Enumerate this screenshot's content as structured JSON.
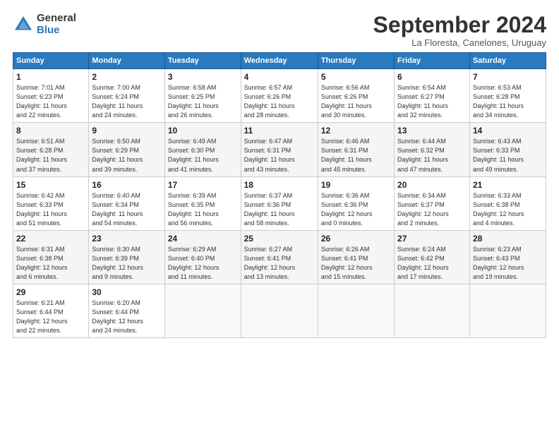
{
  "logo": {
    "general": "General",
    "blue": "Blue"
  },
  "title": "September 2024",
  "subtitle": "La Floresta, Canelones, Uruguay",
  "headers": [
    "Sunday",
    "Monday",
    "Tuesday",
    "Wednesday",
    "Thursday",
    "Friday",
    "Saturday"
  ],
  "weeks": [
    [
      {
        "day": "1",
        "info": "Sunrise: 7:01 AM\nSunset: 6:23 PM\nDaylight: 11 hours\nand 22 minutes."
      },
      {
        "day": "2",
        "info": "Sunrise: 7:00 AM\nSunset: 6:24 PM\nDaylight: 11 hours\nand 24 minutes."
      },
      {
        "day": "3",
        "info": "Sunrise: 6:58 AM\nSunset: 6:25 PM\nDaylight: 11 hours\nand 26 minutes."
      },
      {
        "day": "4",
        "info": "Sunrise: 6:57 AM\nSunset: 6:26 PM\nDaylight: 11 hours\nand 28 minutes."
      },
      {
        "day": "5",
        "info": "Sunrise: 6:56 AM\nSunset: 6:26 PM\nDaylight: 11 hours\nand 30 minutes."
      },
      {
        "day": "6",
        "info": "Sunrise: 6:54 AM\nSunset: 6:27 PM\nDaylight: 11 hours\nand 32 minutes."
      },
      {
        "day": "7",
        "info": "Sunrise: 6:53 AM\nSunset: 6:28 PM\nDaylight: 11 hours\nand 34 minutes."
      }
    ],
    [
      {
        "day": "8",
        "info": "Sunrise: 6:51 AM\nSunset: 6:28 PM\nDaylight: 11 hours\nand 37 minutes."
      },
      {
        "day": "9",
        "info": "Sunrise: 6:50 AM\nSunset: 6:29 PM\nDaylight: 11 hours\nand 39 minutes."
      },
      {
        "day": "10",
        "info": "Sunrise: 6:49 AM\nSunset: 6:30 PM\nDaylight: 11 hours\nand 41 minutes."
      },
      {
        "day": "11",
        "info": "Sunrise: 6:47 AM\nSunset: 6:31 PM\nDaylight: 11 hours\nand 43 minutes."
      },
      {
        "day": "12",
        "info": "Sunrise: 6:46 AM\nSunset: 6:31 PM\nDaylight: 11 hours\nand 45 minutes."
      },
      {
        "day": "13",
        "info": "Sunrise: 6:44 AM\nSunset: 6:32 PM\nDaylight: 11 hours\nand 47 minutes."
      },
      {
        "day": "14",
        "info": "Sunrise: 6:43 AM\nSunset: 6:33 PM\nDaylight: 11 hours\nand 49 minutes."
      }
    ],
    [
      {
        "day": "15",
        "info": "Sunrise: 6:42 AM\nSunset: 6:33 PM\nDaylight: 11 hours\nand 51 minutes."
      },
      {
        "day": "16",
        "info": "Sunrise: 6:40 AM\nSunset: 6:34 PM\nDaylight: 11 hours\nand 54 minutes."
      },
      {
        "day": "17",
        "info": "Sunrise: 6:39 AM\nSunset: 6:35 PM\nDaylight: 11 hours\nand 56 minutes."
      },
      {
        "day": "18",
        "info": "Sunrise: 6:37 AM\nSunset: 6:36 PM\nDaylight: 11 hours\nand 58 minutes."
      },
      {
        "day": "19",
        "info": "Sunrise: 6:36 AM\nSunset: 6:36 PM\nDaylight: 12 hours\nand 0 minutes."
      },
      {
        "day": "20",
        "info": "Sunrise: 6:34 AM\nSunset: 6:37 PM\nDaylight: 12 hours\nand 2 minutes."
      },
      {
        "day": "21",
        "info": "Sunrise: 6:33 AM\nSunset: 6:38 PM\nDaylight: 12 hours\nand 4 minutes."
      }
    ],
    [
      {
        "day": "22",
        "info": "Sunrise: 6:31 AM\nSunset: 6:38 PM\nDaylight: 12 hours\nand 6 minutes."
      },
      {
        "day": "23",
        "info": "Sunrise: 6:30 AM\nSunset: 6:39 PM\nDaylight: 12 hours\nand 9 minutes."
      },
      {
        "day": "24",
        "info": "Sunrise: 6:29 AM\nSunset: 6:40 PM\nDaylight: 12 hours\nand 11 minutes."
      },
      {
        "day": "25",
        "info": "Sunrise: 6:27 AM\nSunset: 6:41 PM\nDaylight: 12 hours\nand 13 minutes."
      },
      {
        "day": "26",
        "info": "Sunrise: 6:26 AM\nSunset: 6:41 PM\nDaylight: 12 hours\nand 15 minutes."
      },
      {
        "day": "27",
        "info": "Sunrise: 6:24 AM\nSunset: 6:42 PM\nDaylight: 12 hours\nand 17 minutes."
      },
      {
        "day": "28",
        "info": "Sunrise: 6:23 AM\nSunset: 6:43 PM\nDaylight: 12 hours\nand 19 minutes."
      }
    ],
    [
      {
        "day": "29",
        "info": "Sunrise: 6:21 AM\nSunset: 6:44 PM\nDaylight: 12 hours\nand 22 minutes."
      },
      {
        "day": "30",
        "info": "Sunrise: 6:20 AM\nSunset: 6:44 PM\nDaylight: 12 hours\nand 24 minutes."
      },
      {
        "day": "",
        "info": ""
      },
      {
        "day": "",
        "info": ""
      },
      {
        "day": "",
        "info": ""
      },
      {
        "day": "",
        "info": ""
      },
      {
        "day": "",
        "info": ""
      }
    ]
  ]
}
